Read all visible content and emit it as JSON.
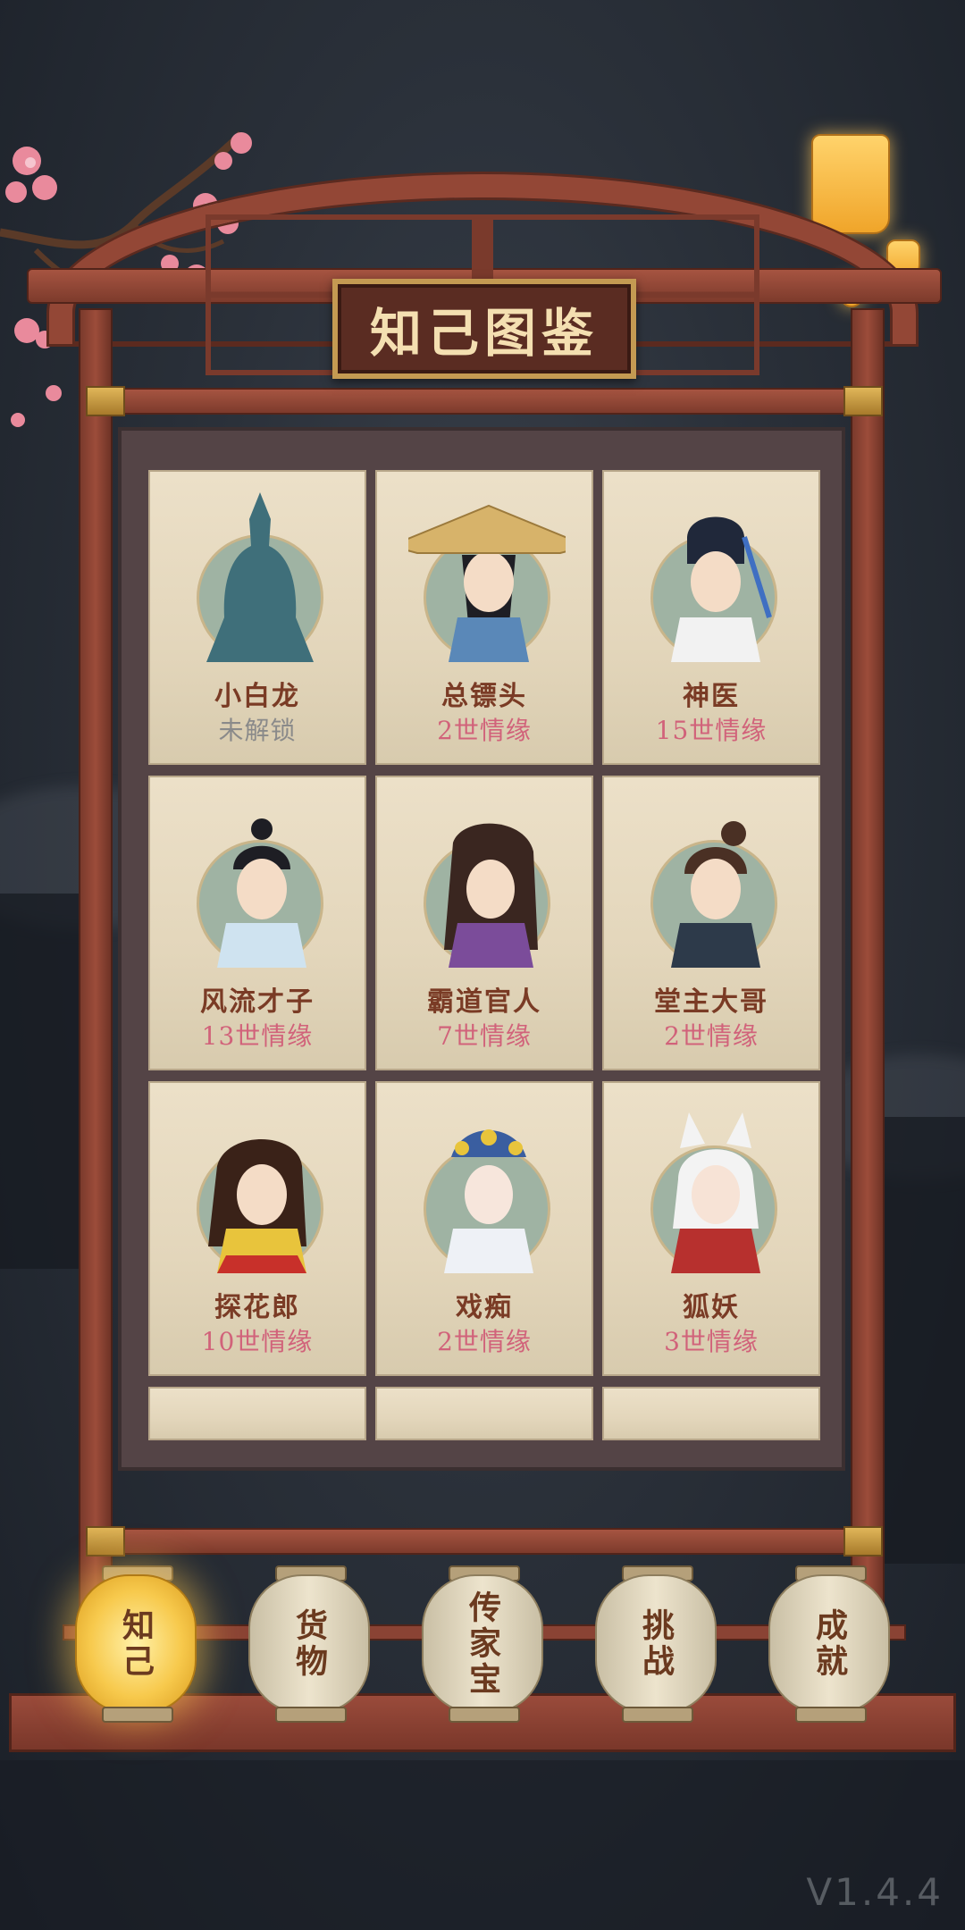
{
  "title": "知己图鉴",
  "characters": [
    {
      "name": "小白龙",
      "status": "未解锁",
      "locked": true
    },
    {
      "name": "总镖头",
      "status": "2世情缘",
      "locked": false
    },
    {
      "name": "神医",
      "status": "15世情缘",
      "locked": false
    },
    {
      "name": "风流才子",
      "status": "13世情缘",
      "locked": false
    },
    {
      "name": "霸道官人",
      "status": "7世情缘",
      "locked": false
    },
    {
      "name": "堂主大哥",
      "status": "2世情缘",
      "locked": false
    },
    {
      "name": "探花郎",
      "status": "10世情缘",
      "locked": false
    },
    {
      "name": "戏痴",
      "status": "2世情缘",
      "locked": false
    },
    {
      "name": "狐妖",
      "status": "3世情缘",
      "locked": false
    }
  ],
  "nav": [
    {
      "label": "知己",
      "active": true
    },
    {
      "label": "货物",
      "active": false
    },
    {
      "label": "传家宝",
      "active": false
    },
    {
      "label": "挑战",
      "active": false
    },
    {
      "label": "成就",
      "active": false
    }
  ],
  "version": "V1.4.4",
  "colors": {
    "frame": "#934736",
    "card": "#e6d9bf",
    "name": "#7a3b25",
    "status": "#d1627a",
    "locked": "#8a8a8a",
    "active_lantern": "#f7c94c"
  }
}
